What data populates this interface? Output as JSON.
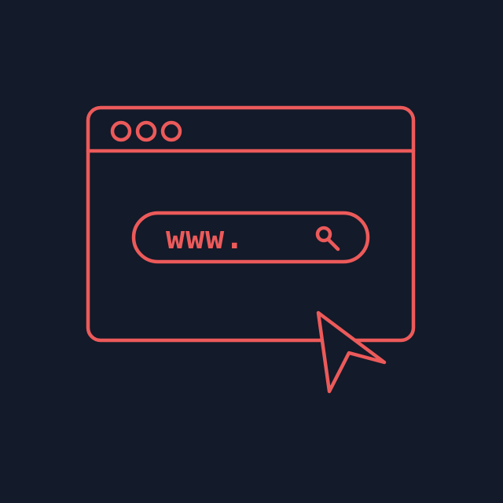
{
  "theme": {
    "background": "#131a29",
    "accent": "#ec5a5a"
  },
  "browser": {
    "window_controls": [
      "dot",
      "dot",
      "dot"
    ],
    "address_bar": {
      "text": "www.",
      "icon": "search-icon"
    }
  },
  "cursor": {
    "icon": "mouse-pointer-icon"
  }
}
